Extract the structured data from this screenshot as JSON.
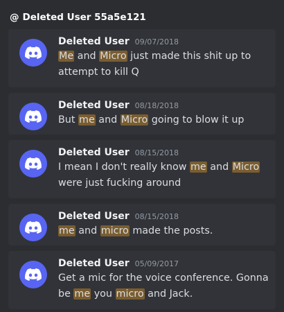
{
  "header": {
    "at_symbol": "@",
    "title": "Deleted User 55a5e121"
  },
  "results": [
    {
      "author": "Deleted User",
      "date": "09/07/2018",
      "segments": [
        {
          "t": "Me",
          "hl": true
        },
        {
          "t": " and ",
          "hl": false
        },
        {
          "t": "Micro",
          "hl": true
        },
        {
          "t": " just made this shit up to attempt to kill Q",
          "hl": false
        }
      ]
    },
    {
      "author": "Deleted User",
      "date": "08/18/2018",
      "segments": [
        {
          "t": "But ",
          "hl": false
        },
        {
          "t": "me",
          "hl": true
        },
        {
          "t": " and ",
          "hl": false
        },
        {
          "t": "Micro",
          "hl": true
        },
        {
          "t": " going to blow it up",
          "hl": false
        }
      ]
    },
    {
      "author": "Deleted User",
      "date": "08/15/2018",
      "segments": [
        {
          "t": "I mean I don't really know ",
          "hl": false
        },
        {
          "t": "me",
          "hl": true
        },
        {
          "t": " and ",
          "hl": false
        },
        {
          "t": "Micro",
          "hl": true
        },
        {
          "t": " were just fucking around",
          "hl": false
        }
      ]
    },
    {
      "author": "Deleted User",
      "date": "08/15/2018",
      "segments": [
        {
          "t": "me",
          "hl": true
        },
        {
          "t": " and ",
          "hl": false
        },
        {
          "t": "micro",
          "hl": true
        },
        {
          "t": " made the posts.",
          "hl": false
        }
      ]
    },
    {
      "author": "Deleted User",
      "date": "05/09/2017",
      "segments": [
        {
          "t": "Get a mic for the voice conference. Gonna be ",
          "hl": false
        },
        {
          "t": "me",
          "hl": true
        },
        {
          "t": " you ",
          "hl": false
        },
        {
          "t": "micro",
          "hl": true
        },
        {
          "t": " and Jack.",
          "hl": false
        }
      ]
    }
  ],
  "icons": {
    "avatar": "discord-logo-icon"
  },
  "colors": {
    "background": "#2b2d31",
    "card": "#313338",
    "avatar": "#5865f2",
    "highlight": "#7a5d30",
    "author": "#f2f3f5",
    "date": "#949ba4",
    "text": "#dbdee1"
  }
}
